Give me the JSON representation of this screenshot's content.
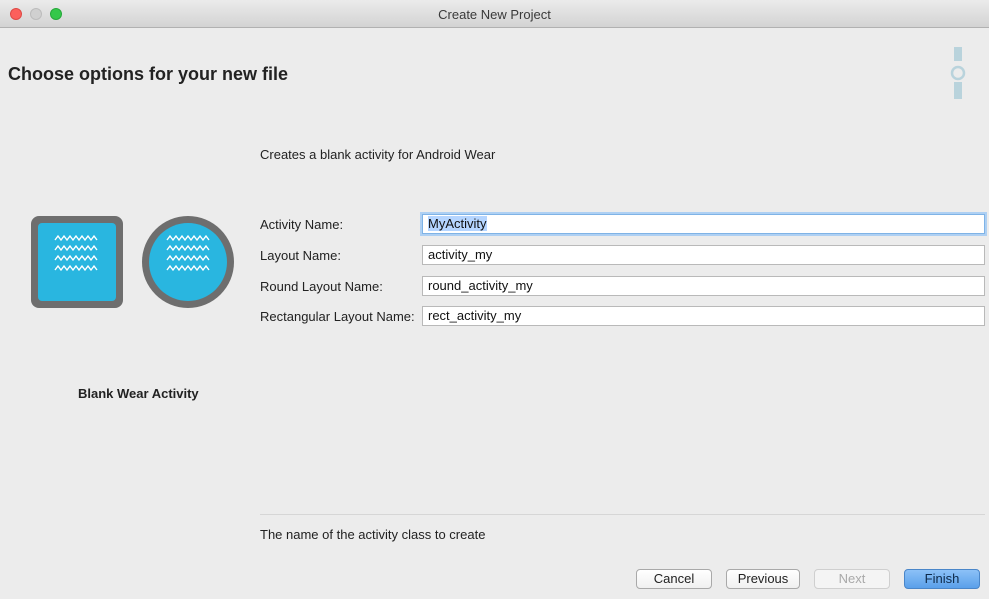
{
  "window": {
    "title": "Create New Project",
    "controls": [
      "close",
      "minimize",
      "maximize"
    ]
  },
  "header": {
    "title": "Choose options for your new file",
    "icon": "android-wear-icon"
  },
  "template": {
    "name": "Blank Wear Activity",
    "description": "Creates a blank activity for Android Wear",
    "preview_icons": [
      "square-watch-icon",
      "round-watch-icon"
    ],
    "accent_color": "#29b6e0"
  },
  "form": {
    "fields": [
      {
        "label": "Activity Name:",
        "value": "MyActivity",
        "focused": true
      },
      {
        "label": "Layout Name:",
        "value": "activity_my"
      },
      {
        "label": "Round Layout Name:",
        "value": "round_activity_my"
      },
      {
        "label": "Rectangular Layout Name:",
        "value": "rect_activity_my"
      }
    ]
  },
  "hint": "The name of the activity class to create",
  "buttons": {
    "cancel": "Cancel",
    "previous": "Previous",
    "next": "Next",
    "finish": "Finish"
  }
}
